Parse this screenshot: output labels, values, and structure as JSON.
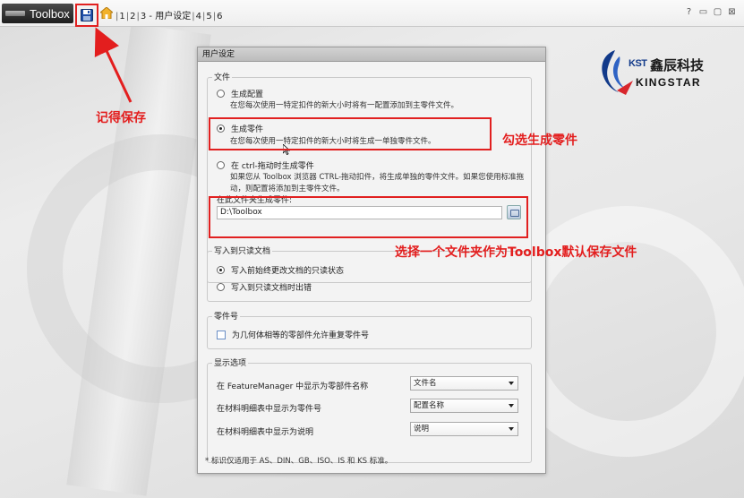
{
  "titlebar": {
    "app_name": "Toolbox",
    "breadcrumb": [
      {
        "label": "1"
      },
      {
        "label": "2"
      },
      {
        "label": "3 - 用户设定"
      },
      {
        "label": "4"
      },
      {
        "label": "5"
      },
      {
        "label": "6"
      }
    ]
  },
  "brand": {
    "kst": "KST",
    "name_cn": "鑫辰科技",
    "name_en": "KINGSTAR"
  },
  "annotations": {
    "save_note": "记得保存",
    "check_note": "勾选生成零件",
    "folder_note": "选择一个文件夹作为Toolbox默认保存文件"
  },
  "dialog": {
    "title": "用户设定",
    "file_group": {
      "title": "文件",
      "options": [
        {
          "label": "生成配置",
          "desc": "在您每次使用一特定扣件的新大小时将有一配置添加到主零件文件。",
          "checked": false
        },
        {
          "label": "生成零件",
          "desc": "在您每次使用一特定扣件的新大小时将生成一单独零件文件。",
          "checked": true
        },
        {
          "label": "在 ctrl-拖动时生成零件",
          "desc": "如果您从 Toolbox 浏览器 CTRL-拖动扣件，将生成单独的零件文件。如果您使用标准拖动，则配置将添加到主零件文件。",
          "checked": false
        }
      ],
      "folder_label": "在此文件夹生成零件:",
      "folder_value": "D:\\Toolbox"
    },
    "readonly_group": {
      "title": "写入到只读文档",
      "options": [
        {
          "label": "写入前始终更改文档的只读状态",
          "checked": true
        },
        {
          "label": "写入到只读文档时出错",
          "checked": false
        }
      ]
    },
    "part_number_group": {
      "title": "零件号",
      "checkbox_label": "为几何体相等的零部件允许重复零件号",
      "checked": false
    },
    "display_group": {
      "title": "显示选项",
      "rows": [
        {
          "label": "在 FeatureManager 中显示为零部件名称",
          "value": "文件名"
        },
        {
          "label": "在材料明细表中显示为零件号",
          "value": "配置名称"
        },
        {
          "label": "在材料明细表中显示为说明",
          "value": "说明"
        }
      ],
      "footnote": "* 标识仅适用于 AS、DIN、GB、ISO、IS 和 KS 标准。"
    }
  },
  "colors": {
    "annotation": "#e31e1e",
    "brand_blue": "#123a8a"
  }
}
